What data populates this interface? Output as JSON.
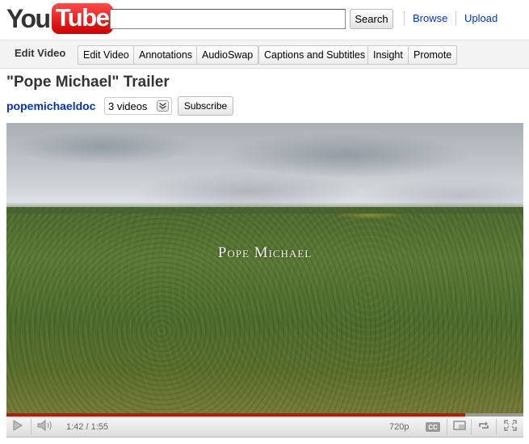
{
  "header": {
    "logo_you": "You",
    "logo_tube": "Tube",
    "search": {
      "value": "",
      "placeholder": "",
      "button_label": "Search"
    },
    "nav": {
      "browse": "Browse",
      "upload": "Upload"
    }
  },
  "owner_bar": {
    "title": "Edit Video",
    "buttons": [
      "Edit Video",
      "Annotations",
      "AudioSwap",
      "Captions and Subtitles",
      "Insight",
      "Promote"
    ]
  },
  "video": {
    "title": "\"Pope Michael\" Trailer",
    "channel": "popemichaeldoc",
    "videos_count_label": "3 videos",
    "subscribe_label": "Subscribe",
    "overlay_text": "Pope Michael"
  },
  "player": {
    "current_time": "1:42",
    "duration": "1:55",
    "time_label": "1:42 / 1:55",
    "quality": "720p",
    "cc_label": "CC",
    "played_fraction": 0.887,
    "buffered_fraction": 1.0
  },
  "icons": {
    "play": "play-icon",
    "volume": "volume-icon",
    "cc": "captions-icon",
    "popout": "popout-icon",
    "loop": "loop-icon",
    "fullscreen": "fullscreen-icon",
    "dropdown": "chevron-down-icon"
  },
  "colors": {
    "link": "#0033cc",
    "logo_red": "#cc0000",
    "progress_played": "#c4140b"
  }
}
